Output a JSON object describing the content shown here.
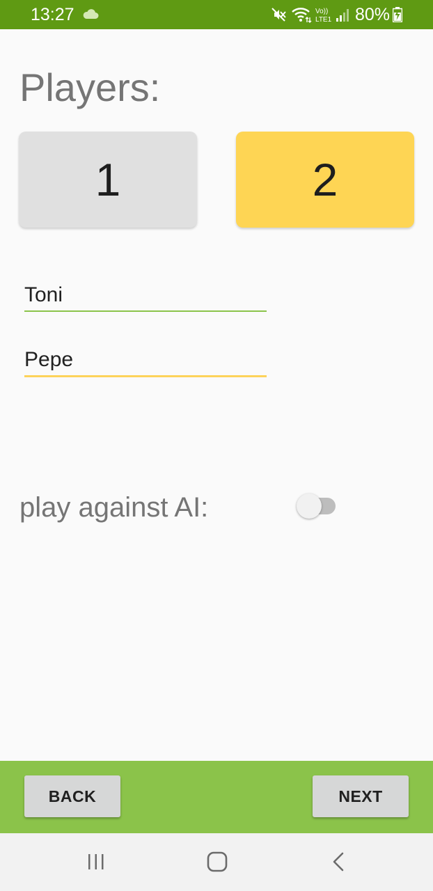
{
  "status_bar": {
    "time": "13:27",
    "battery": "80%",
    "icons": [
      "cloud-icon",
      "mute-icon",
      "wifi-icon",
      "volte-lte-icon",
      "signal-icon",
      "battery-charging-icon"
    ]
  },
  "title": "Players:",
  "player_count": {
    "options": [
      "1",
      "2"
    ],
    "selected": "2"
  },
  "players": [
    {
      "name": "Toni",
      "underline_color": "#8bc34a"
    },
    {
      "name": "Pepe",
      "underline_color": "#fdd35a"
    }
  ],
  "ai": {
    "label": "play against AI:",
    "enabled": false
  },
  "buttons": {
    "back": "BACK",
    "next": "NEXT"
  },
  "colors": {
    "status_bar": "#5f9a13",
    "bottom_bar": "#8bc34a",
    "selected_count": "#fed554",
    "unselected_count": "#e0e0e0"
  },
  "nav_bar": {
    "icons": [
      "recents-icon",
      "home-icon",
      "back-icon"
    ]
  }
}
